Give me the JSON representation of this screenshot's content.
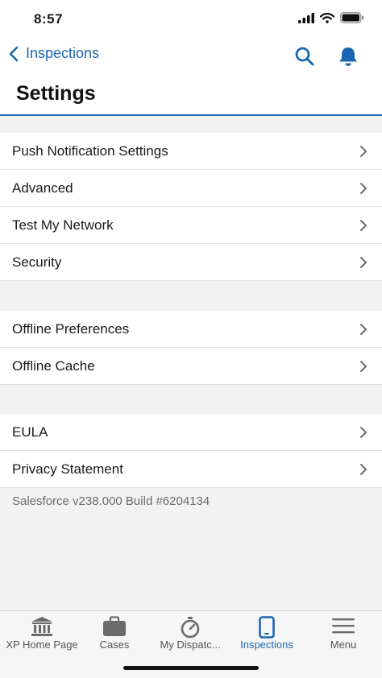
{
  "status_bar": {
    "time": "8:57"
  },
  "nav": {
    "back_label": "Inspections",
    "title": "Settings",
    "accent": "#1b66b1"
  },
  "groups": [
    {
      "items": [
        {
          "label": "Push Notification Settings"
        },
        {
          "label": "Advanced"
        },
        {
          "label": "Test My Network"
        },
        {
          "label": "Security"
        }
      ]
    },
    {
      "items": [
        {
          "label": "Offline Preferences"
        },
        {
          "label": "Offline Cache"
        }
      ]
    },
    {
      "items": [
        {
          "label": "EULA"
        },
        {
          "label": "Privacy Statement"
        }
      ]
    }
  ],
  "version_text": "Salesforce v238.000 Build #6204134",
  "tabs": [
    {
      "label": "XP Home Page",
      "icon": "bank-icon"
    },
    {
      "label": "Cases",
      "icon": "briefcase-icon"
    },
    {
      "label": "My Dispatc...",
      "icon": "stopwatch-icon"
    },
    {
      "label": "Inspections",
      "icon": "phone-icon",
      "active": true
    },
    {
      "label": "Menu",
      "icon": "menu-icon"
    }
  ]
}
